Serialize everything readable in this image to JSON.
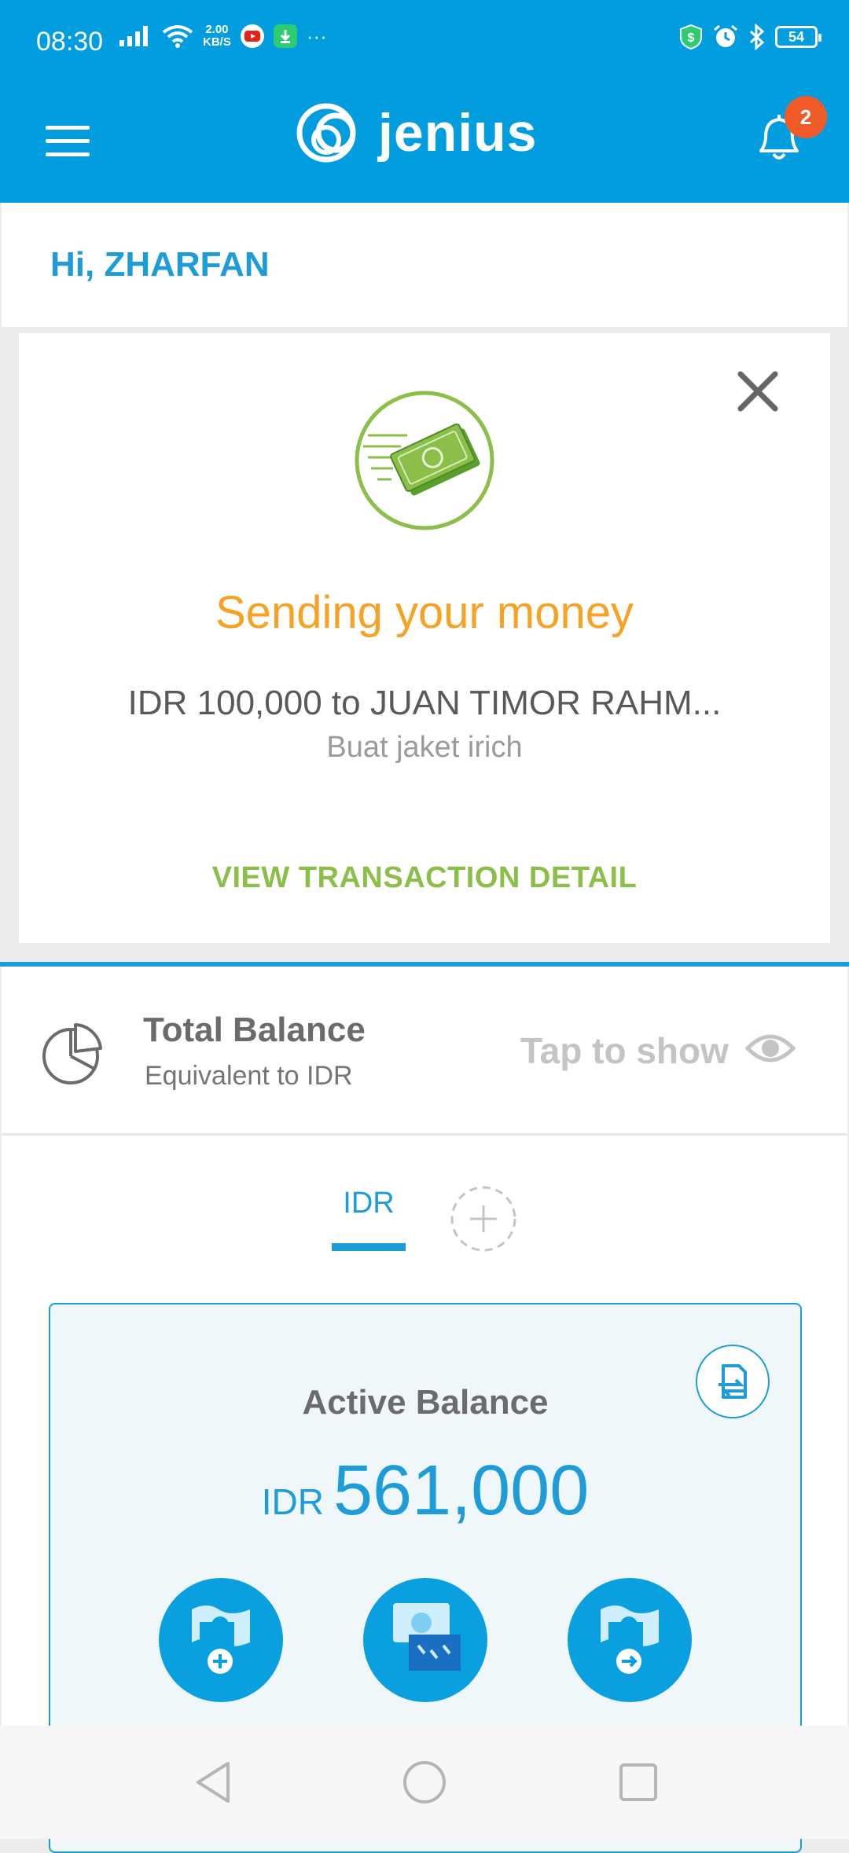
{
  "status_bar": {
    "time": "08:30",
    "speed_value": "2.00",
    "speed_unit": "KB/S",
    "battery": "54"
  },
  "header": {
    "logo_text": "jenius",
    "notification_count": "2"
  },
  "greeting": "Hi, ZHARFAN",
  "sending_card": {
    "title": "Sending your money",
    "amount_line": "IDR 100,000 to JUAN TIMOR RAHM...",
    "note": "Buat jaket irich",
    "action_label": "VIEW TRANSACTION DETAIL"
  },
  "total_balance": {
    "title": "Total Balance",
    "subtitle": "Equivalent to IDR",
    "reveal_label": "Tap to show"
  },
  "currency_tabs": [
    {
      "label": "IDR",
      "selected": true
    }
  ],
  "active_balance": {
    "title": "Active Balance",
    "currency": "IDR",
    "amount": "561,000"
  },
  "colors": {
    "brand_blue": "#019dde",
    "accent_blue": "#1d9cd8",
    "orange": "#f7a125",
    "green": "#8cbe4a",
    "badge": "#f05a28"
  },
  "icons": {
    "menu": "hamburger-icon",
    "notifications": "bell-icon",
    "close": "close-icon",
    "sending": "money-transfer-icon",
    "balance": "pie-chart-icon",
    "show": "eye-icon",
    "add_currency": "plus-icon",
    "history": "transfer-history-icon",
    "top_up": "money-add-icon",
    "withdraw": "atm-withdraw-icon",
    "transfer": "money-send-icon"
  }
}
